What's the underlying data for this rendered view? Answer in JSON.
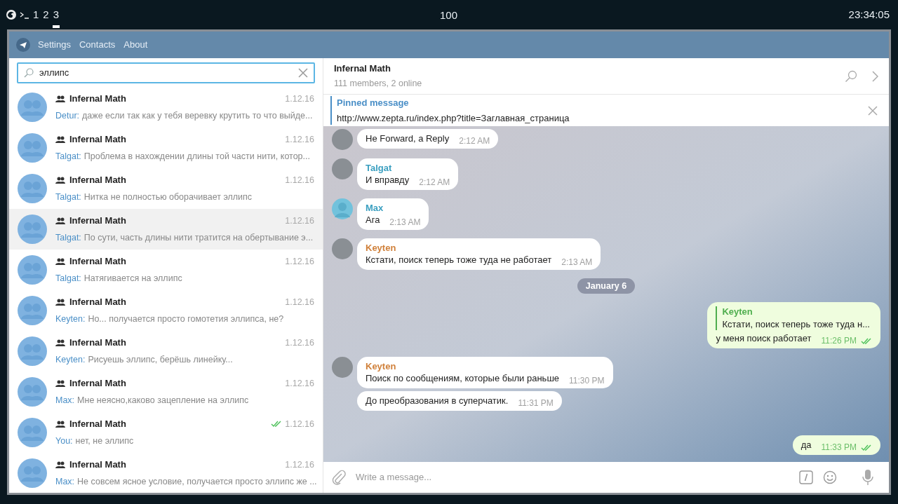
{
  "top_bar": {
    "workspaces": [
      {
        "label": "1",
        "selected": false
      },
      {
        "label": "2",
        "selected": false
      },
      {
        "label": "3",
        "selected": true
      }
    ],
    "center_text": "100",
    "clock": "23:34:05"
  },
  "menu": [
    "Settings",
    "Contacts",
    "About"
  ],
  "search": {
    "value": "эллипс"
  },
  "chats": [
    {
      "title": "Infernal Math",
      "sender": "Detur:",
      "text": "даже если так как у тебя веревку крутить то что выйде...",
      "date": "1.12.16",
      "read": false,
      "selected": false
    },
    {
      "title": "Infernal Math",
      "sender": "Talgat:",
      "text": "Проблема в нахождении длины той части нити, котор...",
      "date": "1.12.16",
      "read": false,
      "selected": false
    },
    {
      "title": "Infernal Math",
      "sender": "Talgat:",
      "text": "Нитка не полностью оборачивает эллипс",
      "date": "1.12.16",
      "read": false,
      "selected": false
    },
    {
      "title": "Infernal Math",
      "sender": "Talgat:",
      "text": "По сути, часть длины нити тратится на обертывание э...",
      "date": "1.12.16",
      "read": false,
      "selected": true
    },
    {
      "title": "Infernal Math",
      "sender": "Talgat:",
      "text": "Натягивается на эллипс",
      "date": "1.12.16",
      "read": false,
      "selected": false
    },
    {
      "title": "Infernal Math",
      "sender": "Keyten:",
      "text": "Но... получается просто гомотетия эллипса, не?",
      "date": "1.12.16",
      "read": false,
      "selected": false
    },
    {
      "title": "Infernal Math",
      "sender": "Keyten:",
      "text": "Рисуешь эллипс, берёшь линейку...",
      "date": "1.12.16",
      "read": false,
      "selected": false
    },
    {
      "title": "Infernal Math",
      "sender": "Max:",
      "text": "Мне неясно,каково зацепление на эллипс",
      "date": "1.12.16",
      "read": false,
      "selected": false
    },
    {
      "title": "Infernal Math",
      "sender": "You:",
      "text": "нет, не эллипс",
      "date": "1.12.16",
      "read": true,
      "selected": false
    },
    {
      "title": "Infernal Math",
      "sender": "Max:",
      "text": "Не совсем ясное условие, получается просто эллипс же ...",
      "date": "1.12.16",
      "read": false,
      "selected": false
    }
  ],
  "chat_header": {
    "title": "Infernal Math",
    "subtitle": "111 members, 2 online"
  },
  "pinned": {
    "label": "Pinned message",
    "text": "http://www.zepta.ru/index.php?title=Заглавная_страница"
  },
  "messages": [
    {
      "kind": "incoming",
      "avatar": {
        "kind": "photo"
      },
      "text": "Не Forward, a Reply",
      "time": "2:12 AM"
    },
    {
      "kind": "incoming",
      "avatar": {
        "kind": "photo"
      },
      "sender": "Talgat",
      "color": "#3a9fc0",
      "text": "И вправду",
      "time": "2:12 AM"
    },
    {
      "kind": "incoming",
      "avatar": {
        "kind": "silhouette"
      },
      "sender": "Max",
      "color": "#3a9fc0",
      "text": "Ага",
      "time": "2:13 AM"
    },
    {
      "kind": "incoming",
      "avatar": {
        "kind": "photo"
      },
      "sender": "Keyten",
      "color": "#d0803a",
      "text": "Кстати, поиск теперь тоже туда не работает",
      "time": "2:13 AM"
    },
    {
      "kind": "date",
      "text": "January 6"
    },
    {
      "kind": "outgoing",
      "reply": {
        "sender": "Keyten",
        "text": "Кстати, поиск теперь тоже туда н..."
      },
      "text": "у меня поиск работает",
      "time": "11:26 PM",
      "read": true
    },
    {
      "kind": "incoming",
      "avatar": {
        "kind": "photo"
      },
      "sender": "Keyten",
      "color": "#d0803a",
      "text": "Поиск по сообщениям, которые были раньше",
      "time": "11:30 PM"
    },
    {
      "kind": "incoming",
      "text": "До преобразования в суперчатик.",
      "time": "11:31 PM"
    },
    {
      "kind": "outgoing",
      "text": "да",
      "time": "11:33 PM",
      "read": true
    }
  ],
  "composer": {
    "placeholder": "Write a message..."
  }
}
